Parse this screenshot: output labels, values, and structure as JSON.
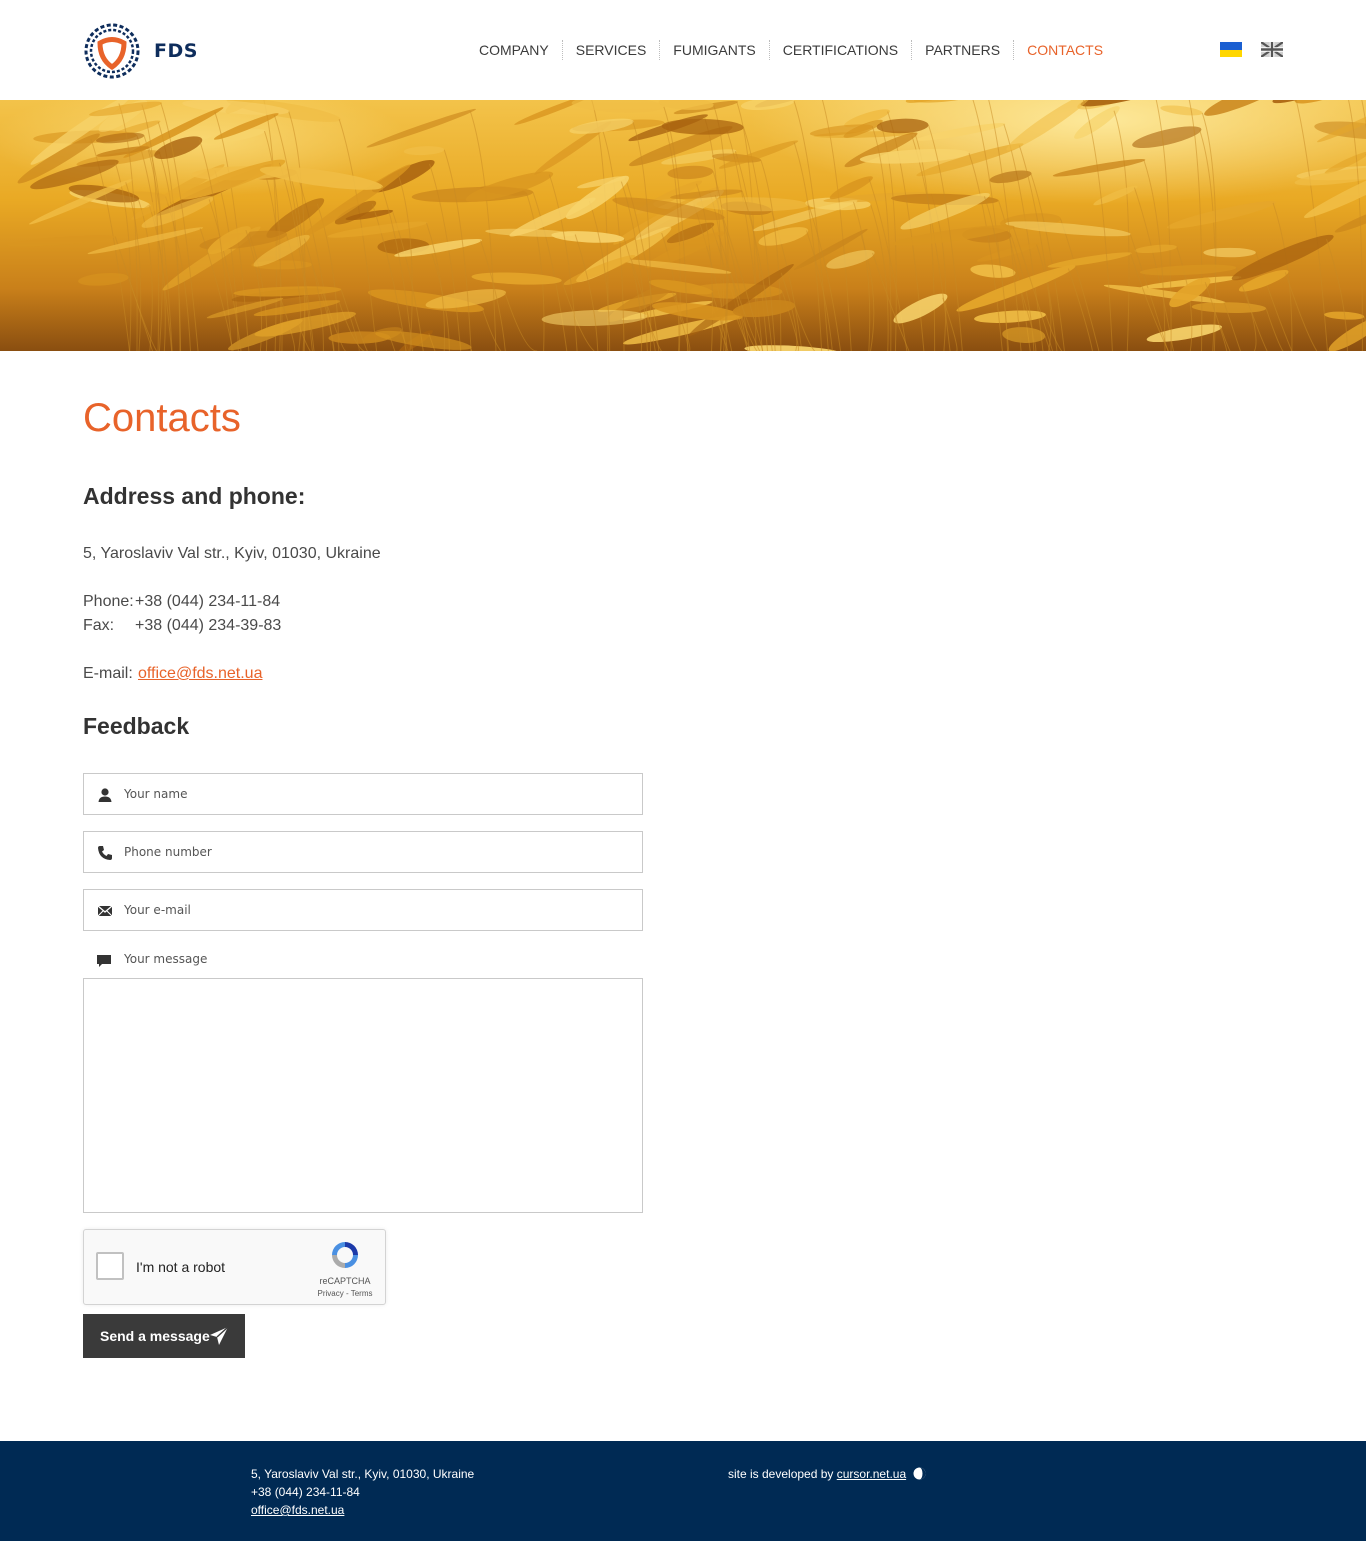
{
  "header": {
    "logo_text": "FDS",
    "nav": [
      {
        "label": "COMPANY",
        "active": false
      },
      {
        "label": "SERVICES",
        "active": false
      },
      {
        "label": "FUMIGANTS",
        "active": false
      },
      {
        "label": "CERTIFICATIONS",
        "active": false
      },
      {
        "label": "PARTNERS",
        "active": false
      },
      {
        "label": "CONTACTS",
        "active": true
      }
    ]
  },
  "colors": {
    "accent": "#e8632a",
    "brand_navy": "#002a54",
    "button": "#3a3a3a"
  },
  "main": {
    "title": "Contacts",
    "address_heading": "Address and phone:",
    "address": "5, Yaroslaviv Val str., Kyiv, 01030, Ukraine",
    "phone_label": "Phone:",
    "phone": "+38 (044) 234-11-84",
    "fax_label": "Fax:",
    "fax": "+38 (044) 234-39-83",
    "email_label": "E-mail:",
    "email": "office@fds.net.ua",
    "feedback_heading": "Feedback"
  },
  "form": {
    "name_placeholder": "Your name",
    "phone_placeholder": "Phone number",
    "email_placeholder": "Your e-mail",
    "message_label": "Your message",
    "captcha_label": "I'm not a robot",
    "captcha_brand": "reCAPTCHA",
    "captcha_links": "Privacy - Terms",
    "submit_label": "Send a message"
  },
  "footer": {
    "address": "5, Yaroslaviv Val str., Kyiv, 01030, Ukraine",
    "phone": "+38 (044) 234-11-84",
    "email": "office@fds.net.ua",
    "dev_prefix": "site is developed by",
    "dev_link": "cursor.net.ua"
  }
}
